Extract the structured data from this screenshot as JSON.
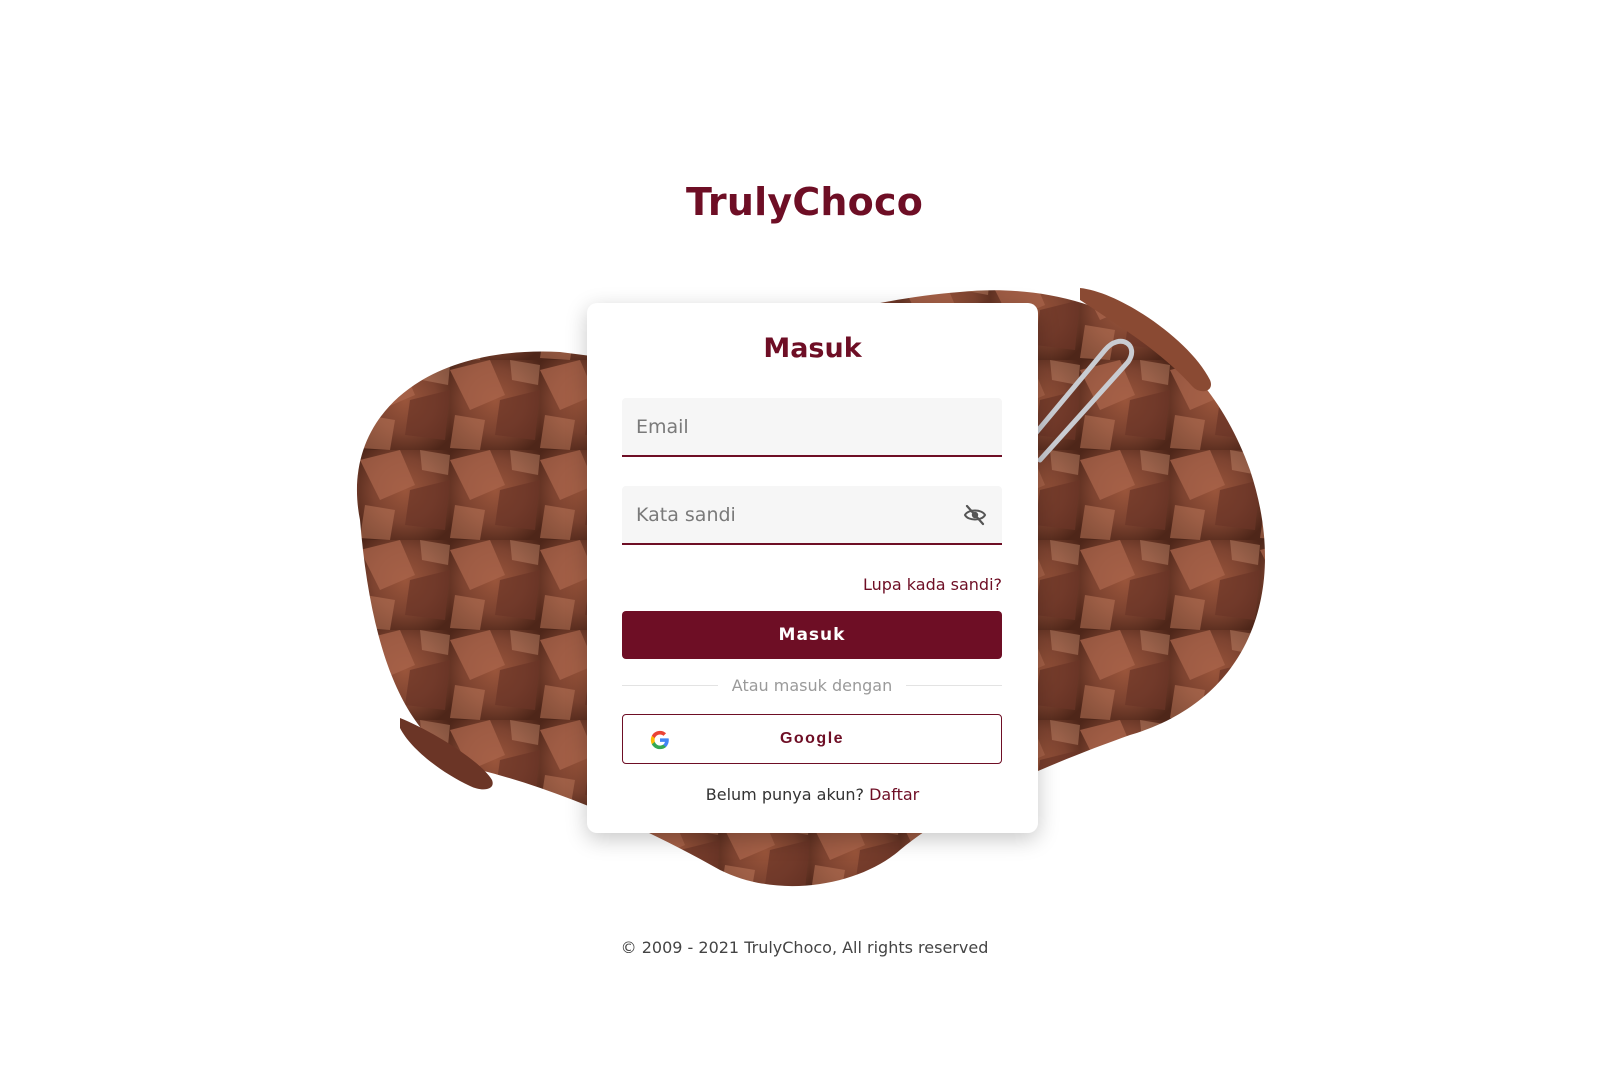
{
  "brand": {
    "name": "TrulyChoco"
  },
  "login": {
    "title": "Masuk",
    "email_placeholder": "Email",
    "password_placeholder": "Kata sandi",
    "forgot_label": "Lupa kada sandi?",
    "submit_label": "Masuk",
    "divider_label": "Atau masuk dengan",
    "google_label": "Google",
    "signup_prompt": "Belum punya akun?",
    "signup_link": "Daftar"
  },
  "footer": {
    "copyright": "© 2009 - 2021 TrulyChoco, All rights reserved"
  },
  "colors": {
    "brand": "#6e0e25",
    "chocolate": "#8a4a33"
  },
  "icons": {
    "password_toggle": "eye-off-icon",
    "google": "google-icon"
  }
}
